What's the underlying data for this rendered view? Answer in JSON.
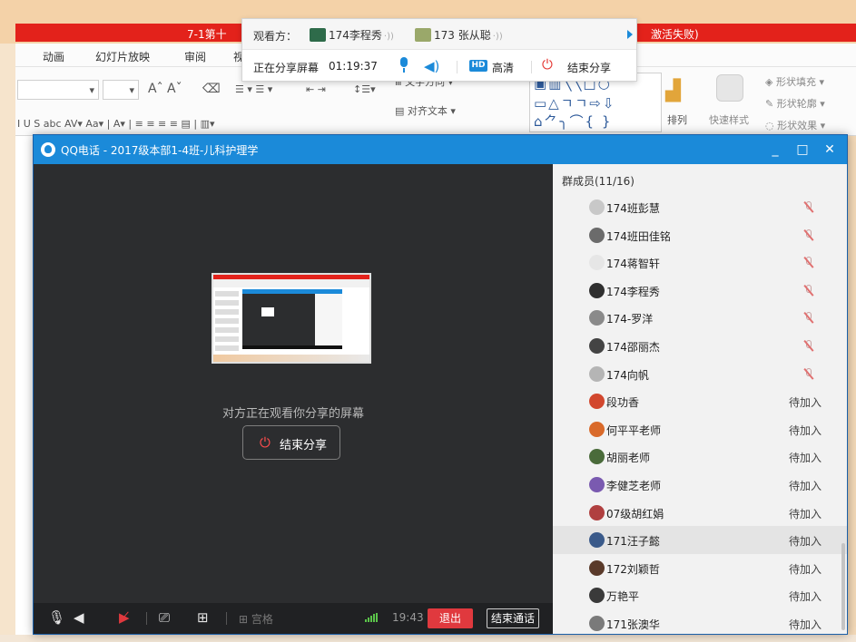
{
  "ppt": {
    "title_left": "7-1第十",
    "title_right": "激活失败)",
    "menu": [
      "动画",
      "幻灯片放映",
      "审阅",
      "视"
    ],
    "ribbon": {
      "text_direction": "文字方向",
      "align_text": "对齐文本",
      "arrange": "排列",
      "quick_styles": "快速样式",
      "shape_fill": "形状填充",
      "shape_outline": "形状轮廓",
      "shape_effects": "形状效果"
    }
  },
  "share_panel": {
    "viewers_label": "观看方：",
    "viewers": [
      {
        "name": "174李程秀",
        "avatar_color": "#2e6b4a"
      },
      {
        "name": "173 张从聪",
        "avatar_color": "#9aa86a"
      }
    ],
    "sharing_status": "正在分享屏幕",
    "timer": "01:19:37",
    "hd_badge": "HD",
    "hd_label": "高清",
    "end_share_label": "结束分享"
  },
  "window": {
    "title": "QQ电话 - 2017级本部1-4班-儿科护理学",
    "minimize": "_",
    "maximize": "□",
    "close": "✕"
  },
  "stage": {
    "caption": "对方正在观看你分享的屏幕",
    "end_share_label": "结束分享"
  },
  "toolbar": {
    "grid_label": "宫格",
    "time": "19:43",
    "exit_label": "退出",
    "end_call_label": "结束通话"
  },
  "members": {
    "header": "群成员(11/16)",
    "list": [
      {
        "name": "174班彭慧",
        "status": "",
        "muted": true,
        "avatar_color": "#c8c8c8"
      },
      {
        "name": "174班田佳铭",
        "status": "",
        "muted": true,
        "avatar_color": "#6b6b6b"
      },
      {
        "name": "174蒋智轩",
        "status": "",
        "muted": true,
        "avatar_color": "#e6e6e6"
      },
      {
        "name": "174李程秀",
        "status": "",
        "muted": true,
        "avatar_color": "#2f2f2f"
      },
      {
        "name": "174-罗洋",
        "status": "",
        "muted": true,
        "avatar_color": "#8a8a8a"
      },
      {
        "name": "174邵丽杰",
        "status": "",
        "muted": true,
        "avatar_color": "#444444"
      },
      {
        "name": "174向帆",
        "status": "",
        "muted": true,
        "avatar_color": "#b5b5b5"
      },
      {
        "name": "段功香",
        "status": "待加入",
        "muted": false,
        "avatar_color": "#d2472e"
      },
      {
        "name": "何平平老师",
        "status": "待加入",
        "muted": false,
        "avatar_color": "#d96a2a"
      },
      {
        "name": "胡丽老师",
        "status": "待加入",
        "muted": false,
        "avatar_color": "#4a6b3a"
      },
      {
        "name": "李健芝老师",
        "status": "待加入",
        "muted": false,
        "avatar_color": "#7a5ab0"
      },
      {
        "name": "07级胡红娟",
        "status": "待加入",
        "muted": false,
        "avatar_color": "#b04040"
      },
      {
        "name": "171汪子懿",
        "status": "待加入",
        "muted": false,
        "avatar_color": "#3a5a8a"
      },
      {
        "name": "172刘颖哲",
        "status": "待加入",
        "muted": false,
        "avatar_color": "#5a3a2a"
      },
      {
        "name": "万艳平",
        "status": "待加入",
        "muted": false,
        "avatar_color": "#3a3a3a"
      },
      {
        "name": "171张澳华",
        "status": "待加入",
        "muted": false,
        "avatar_color": "#7a7a7a"
      }
    ]
  },
  "colors": {
    "accent": "#1b8ad9",
    "danger": "#e0393e",
    "ppt_red": "#e3221b"
  }
}
